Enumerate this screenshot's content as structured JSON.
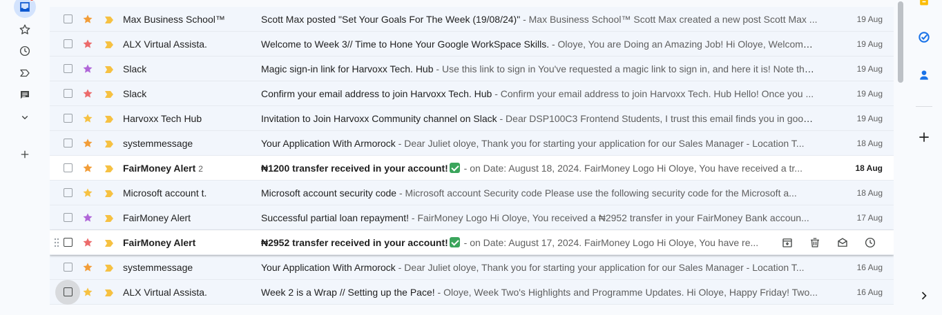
{
  "left_rail": {
    "items": [
      {
        "icon": "inbox-icon"
      },
      {
        "icon": "star-icon"
      },
      {
        "icon": "clock-icon"
      },
      {
        "icon": "label-important-icon"
      },
      {
        "icon": "chat-icon"
      },
      {
        "icon": "chevron-down-icon"
      },
      {
        "icon": "plus-icon"
      }
    ]
  },
  "emails": [
    {
      "sender": "Max Business School™",
      "count": "",
      "subject": "Scott Max posted \"Set Your Goals For The Week (19/08/24)\"",
      "snippet": " - Max Business School™ Scott Max created a new post Scott Max ...",
      "date": "19 Aug",
      "star_color": "#f29d38",
      "unread": false
    },
    {
      "sender": "ALX Virtual Assista.",
      "count": "",
      "subject": "Welcome to Week 3// Time to Hone Your Google WorkSpace Skills.",
      "snippet": " - Oloye, You are Doing an Amazing Job! Hi Oloye, Welcome to ...",
      "date": "19 Aug",
      "star_color": "#ec6b6b",
      "unread": false
    },
    {
      "sender": "Slack",
      "count": "",
      "subject": "Magic sign-in link for Harvoxx Tech. Hub",
      "snippet": " - Use this link to sign in You've requested a magic link to sign in, and here it is! Note that ...",
      "date": "19 Aug",
      "star_color": "#b066d8",
      "unread": false
    },
    {
      "sender": "Slack",
      "count": "",
      "subject": "Confirm your email address to join Harvoxx Tech. Hub",
      "snippet": " - Confirm your email address to join Harvoxx Tech. Hub Hello! Once you ...",
      "date": "19 Aug",
      "star_color": "#ec6b6b",
      "unread": false
    },
    {
      "sender": "Harvoxx Tech Hub",
      "count": "",
      "subject": "Invitation to Join Harvoxx Community channel on Slack",
      "snippet": " - Dear DSP100C3 Frontend Students, I trust this email finds you in good ...",
      "date": "19 Aug",
      "star_color": "#f6c142",
      "unread": false
    },
    {
      "sender": "systemmessage",
      "count": "",
      "subject": "Your Application With Armorock",
      "snippet": " - Dear Juliet oloye, Thank you for starting your application for our Sales Manager - Location T...",
      "date": "18 Aug",
      "star_color": "#f29d38",
      "unread": false
    },
    {
      "sender": "FairMoney Alert",
      "count": "2",
      "subject": "₦1200 transfer received in your account!",
      "snippet": " - on Date: August 18, 2024.   FairMoney Logo Hi Oloye, You have received a tr...",
      "date": "18 Aug",
      "star_color": "#f29d38",
      "unread": true,
      "emoji": true
    },
    {
      "sender": "Microsoft account t.",
      "count": "",
      "subject": "Microsoft account security code",
      "snippet": " - Microsoft account Security code Please use the following security code for the Microsoft a...",
      "date": "18 Aug",
      "star_color": "#f6c142",
      "unread": false
    },
    {
      "sender": "FairMoney Alert",
      "count": "",
      "subject": "Successful partial loan repayment!",
      "snippet": " - FairMoney Logo Hi Oloye, You received a ₦2952 transfer in your FairMoney Bank accoun...",
      "date": "17 Aug",
      "star_color": "#b066d8",
      "unread": false
    },
    {
      "sender": "FairMoney Alert",
      "count": "",
      "subject": "₦2952 transfer received in your account!",
      "snippet": " - on Date: August 17, 2024.   FairMoney Logo Hi Oloye, You have re...",
      "date": "",
      "star_color": "#ec6b6b",
      "unread": true,
      "emoji": true,
      "hover": true
    },
    {
      "sender": "systemmessage",
      "count": "",
      "subject": "Your Application With Armorock",
      "snippet": " - Dear Juliet oloye, Thank you for starting your application for our Sales Manager - Location T...",
      "date": "16 Aug",
      "star_color": "#f29d38",
      "unread": false
    },
    {
      "sender": "ALX Virtual Assista.",
      "count": "",
      "subject": "Week 2 is a Wrap // Setting up the Pace!",
      "snippet": " - Oloye, Week Two's Highlights and Programme Updates. Hi Oloye, Happy Friday! Two...",
      "date": "16 Aug",
      "star_color": "#f6c142",
      "unread": false,
      "focus": true
    }
  ],
  "row_actions": [
    {
      "icon": "archive-icon"
    },
    {
      "icon": "delete-icon"
    },
    {
      "icon": "mark-unread-icon"
    },
    {
      "icon": "snooze-icon"
    }
  ],
  "right_rail": {
    "items": [
      {
        "icon": "keep-icon",
        "color": "#fbbc04"
      },
      {
        "icon": "tasks-icon",
        "color": "#1a73e8"
      },
      {
        "icon": "contacts-icon",
        "color": "#1a73e8"
      },
      {
        "icon": "add-icon"
      },
      {
        "icon": "chevron-right-icon"
      }
    ]
  },
  "colors": {
    "important_marker": "#f6c142",
    "unread_dot": "#d93025"
  }
}
